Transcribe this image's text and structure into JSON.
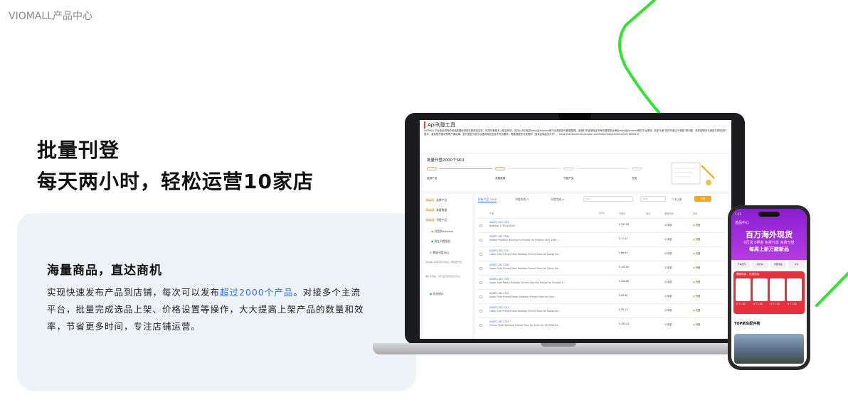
{
  "brand": "VIOMALL产品中心",
  "headline": {
    "line1": "批量刊登",
    "line2": "每天两小时，轻松运营10家店"
  },
  "feature": {
    "title": "海量商品，直达商机",
    "desc_before": "实现快速发布产品到店铺，每次可以发布",
    "desc_highlight": "超过2000个产品",
    "desc_after": "。对接多个主流平台，批量完成选品上架、价格设置等操作，大大提高上架产品的数量和效率，节省更多时间，专注店铺运营。"
  },
  "colors": {
    "accent_green": "#2ee62e",
    "highlight_blue": "#2f6fe4",
    "card_bg": "#eef2f9"
  },
  "laptop_screen": {
    "title": "Api刊登工具",
    "notice": "VIOMALL平台保证所有的商品数据经常核实更新真实的，供您刊登基本上稳定有效，支持公开已知的ebay及Amazon等平台规则进行数据整理。但我们不能够保证所有的数据完全满足ebay及Amazon等的平台规则，如亚马逊“您的刊登过于频繁”等问题，请您按照亚马逊官方规则进行操作，避免账号被封禁等严重后果。若刊登亚马逊平台遇到商品信息不符合要求，需要根据亚马逊规则（登录店铺后台打开）：https://sellercentral.amazon.com/help/hub/reference/G201889410",
    "batch_title": "批量刊登2000个SKU",
    "steps": [
      {
        "pill": "Step1",
        "label": "选择产品"
      },
      {
        "pill": "Step2",
        "label": "准备数据"
      },
      {
        "pill": "Step3",
        "label": "刊登产品"
      },
      {
        "pill": "Done",
        "label": "完成"
      }
    ],
    "side": {
      "step1": "选择产品",
      "step2": "准备数据",
      "step3": "刊登产品",
      "sub1": "刊登到Amazon",
      "sub2": "现在刊登报告",
      "sync": "数量刊登SKU",
      "note1": "请先确认好库存和价格后，再批量刊登。",
      "note2": "确认无误后，将产品刊登到对应平台。",
      "stats": "状态统计"
    },
    "tabs": [
      "所有产品 2000",
      "刊登失败 0",
      "刊登完成 0"
    ],
    "search_placeholder": "SKU",
    "filter_placeholder": "状态",
    "checkbox_label": "未上架",
    "button": "刊登",
    "columns": [
      "产品",
      "ASIN",
      "刊登价",
      "库存",
      "更新时间",
      "状态"
    ],
    "rows": [
      {
        "sku": "AQDYC-182-1761",
        "name": "Radiator 17101436457",
        "price": "$ 221.99",
        "days": "11天前",
        "status": "刊登"
      },
      {
        "sku": "AQDYC-182-1766",
        "name": "Rubber Radiator Bushing for Pontiac for Firebird 1967-1969 ...",
        "price": "$ 11.47",
        "days": "11天前",
        "status": "刊登"
      },
      {
        "sku": "AQDYC-182-1750",
        "name": "Lower Side Primed Steel Radiator Primed Steel for Dodge Em...",
        "price": "$ 86.61",
        "days": "11天前",
        "status": "刊登"
      },
      {
        "sku": "AQDYC-182-1748",
        "name": "Upper Side Primed Steel Radiator Primed Steel for Chevy for...",
        "price": "$ 100.65",
        "days": "11天前",
        "status": "刊登"
      },
      {
        "sku": "AQDYC-182-1758",
        "name": "Upper Side Plastic Radiator Primed Steel for Dodge for Charger S...",
        "price": "$ 200.66",
        "days": "11天前",
        "status": "刊登"
      },
      {
        "sku": "AQDYC-182-1752",
        "name": "Upper Side Primed Plastic Radiator Primed Steel for Ford...",
        "price": "$ 83.95",
        "days": "11天前",
        "status": "刊登"
      },
      {
        "sku": "AQDYC-182-1751",
        "name": "Lower Side Primed Steel Radiator Primed Steel for Dodge for...",
        "price": "$ 50.11",
        "days": "11天前",
        "status": "刊登"
      },
      {
        "sku": "AQDYC-182-1747",
        "name": "Primed Steel Radiator Primed Steel for Scion for xB 2008-20...",
        "price": "$ 163.41",
        "days": "11天前",
        "status": "刊登"
      }
    ]
  },
  "phone": {
    "time": "1:11",
    "nav": "选品中心",
    "big": "百万海外现货",
    "sub": "0压货 0押金 免费代发 免费刊登",
    "sub2": "每周上新万款新品",
    "cats": [
      "汽车配件",
      "摩托车",
      "家居用品",
      "户外"
    ],
    "promo_title": "爆款特卖，热销热卖",
    "prices": [
      "$ 77.82",
      "$ 77.82",
      "$ 77.52",
      "$ 77.82"
    ],
    "top_title": "TOP新车配件榜"
  }
}
